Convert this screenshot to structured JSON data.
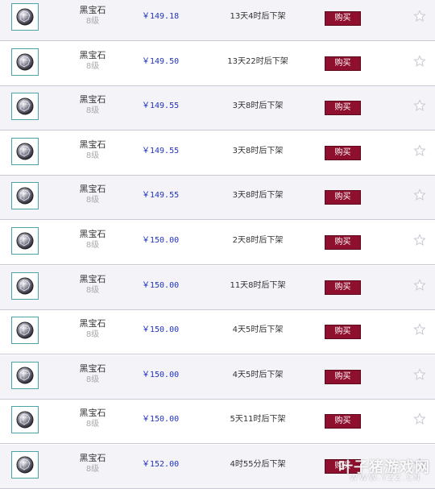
{
  "colors": {
    "row_odd": "#f3f3f8",
    "row_even": "#ffffff",
    "price": "#2233bb",
    "buy_button": "#8e0f2e",
    "thumb_border": "#4aa3a6"
  },
  "item_icon": "black-gem-icon",
  "favorite_icon": "star-outline-icon",
  "listings": [
    {
      "name": "黑宝石",
      "level": "8级",
      "price": "￥149.18",
      "time_left": "13天4时后下架",
      "buy_label": "购买"
    },
    {
      "name": "黑宝石",
      "level": "8级",
      "price": "￥149.50",
      "time_left": "13天22时后下架",
      "buy_label": "购买"
    },
    {
      "name": "黑宝石",
      "level": "8级",
      "price": "￥149.55",
      "time_left": "3天8时后下架",
      "buy_label": "购买"
    },
    {
      "name": "黑宝石",
      "level": "8级",
      "price": "￥149.55",
      "time_left": "3天8时后下架",
      "buy_label": "购买"
    },
    {
      "name": "黑宝石",
      "level": "8级",
      "price": "￥149.55",
      "time_left": "3天8时后下架",
      "buy_label": "购买"
    },
    {
      "name": "黑宝石",
      "level": "8级",
      "price": "￥150.00",
      "time_left": "2天8时后下架",
      "buy_label": "购买"
    },
    {
      "name": "黑宝石",
      "level": "8级",
      "price": "￥150.00",
      "time_left": "11天8时后下架",
      "buy_label": "购买"
    },
    {
      "name": "黑宝石",
      "level": "8级",
      "price": "￥150.00",
      "time_left": "4天5时后下架",
      "buy_label": "购买"
    },
    {
      "name": "黑宝石",
      "level": "8级",
      "price": "￥150.00",
      "time_left": "4天5时后下架",
      "buy_label": "购买"
    },
    {
      "name": "黑宝石",
      "level": "8级",
      "price": "￥150.00",
      "time_left": "5天11时后下架",
      "buy_label": "购买"
    },
    {
      "name": "黑宝石",
      "level": "8级",
      "price": "￥152.00",
      "time_left": "4时55分后下架",
      "buy_label": "购买"
    }
  ],
  "watermark": {
    "brand": "叶子猪游戏网",
    "url": "WWW.YZZ.CN"
  }
}
